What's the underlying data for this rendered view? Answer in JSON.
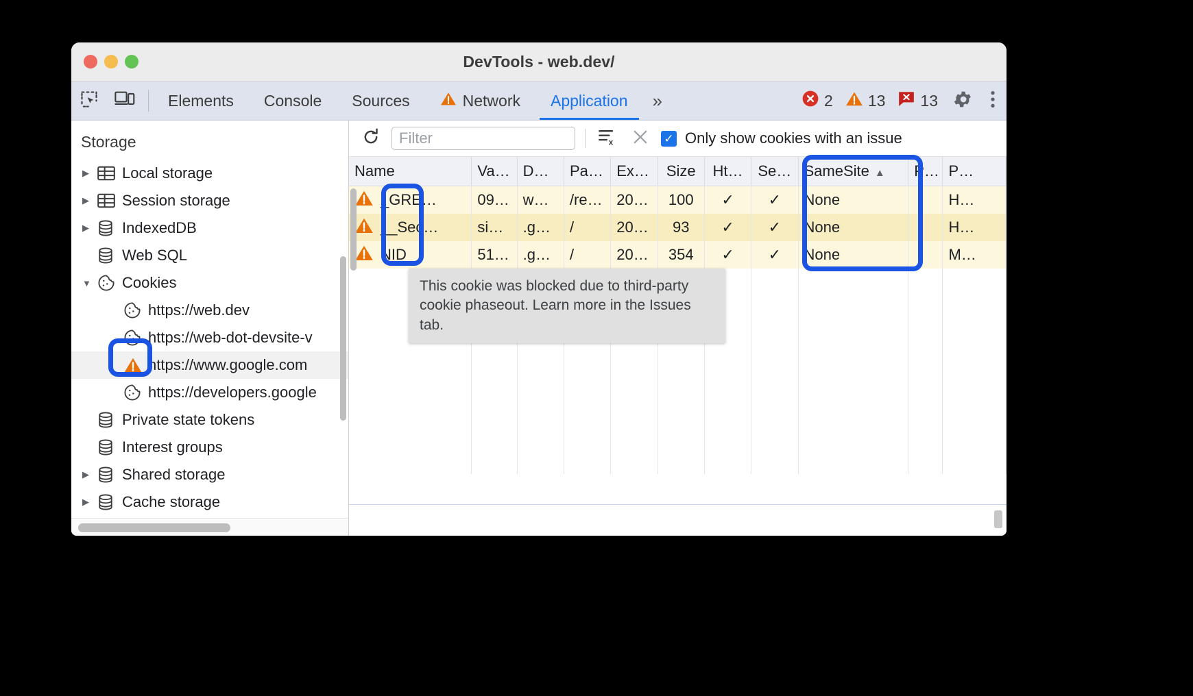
{
  "window": {
    "title": "DevTools - web.dev/"
  },
  "tabstrip": {
    "inspect_icon": "inspect-element-icon",
    "device_icon": "device-toolbar-icon",
    "tabs": [
      {
        "label": "Elements",
        "active": false,
        "warn": false
      },
      {
        "label": "Console",
        "active": false,
        "warn": false
      },
      {
        "label": "Sources",
        "active": false,
        "warn": false
      },
      {
        "label": "Network",
        "active": false,
        "warn": true
      },
      {
        "label": "Application",
        "active": true,
        "warn": false
      }
    ],
    "more_tabs": "»",
    "counters": {
      "errors": "2",
      "warnings": "13",
      "issues": "13"
    },
    "settings_icon": "gear-icon",
    "menu_icon": "kebab-menu-icon"
  },
  "sidebar": {
    "title": "Storage",
    "items": [
      {
        "label": "Local storage",
        "icon": "table-storage-icon",
        "twisty": "collapsed",
        "indent": 1,
        "selected": false
      },
      {
        "label": "Session storage",
        "icon": "table-storage-icon",
        "twisty": "collapsed",
        "indent": 1,
        "selected": false
      },
      {
        "label": "IndexedDB",
        "icon": "database-icon",
        "twisty": "collapsed",
        "indent": 1,
        "selected": false
      },
      {
        "label": "Web SQL",
        "icon": "database-icon",
        "twisty": "none",
        "indent": 1,
        "selected": false
      },
      {
        "label": "Cookies",
        "icon": "cookie-icon",
        "twisty": "expanded",
        "indent": 1,
        "selected": false
      },
      {
        "label": "https://web.dev",
        "icon": "cookie-icon",
        "twisty": "none",
        "indent": 2,
        "selected": false
      },
      {
        "label": "https://web-dot-devsite-v",
        "icon": "cookie-icon",
        "twisty": "none",
        "indent": 2,
        "selected": false
      },
      {
        "label": "https://www.google.com",
        "icon": "warning-triangle-icon",
        "twisty": "none",
        "indent": 2,
        "selected": true
      },
      {
        "label": "https://developers.google",
        "icon": "cookie-icon",
        "twisty": "none",
        "indent": 2,
        "selected": false
      },
      {
        "label": "Private state tokens",
        "icon": "database-icon",
        "twisty": "none",
        "indent": 1,
        "selected": false
      },
      {
        "label": "Interest groups",
        "icon": "database-icon",
        "twisty": "none",
        "indent": 1,
        "selected": false
      },
      {
        "label": "Shared storage",
        "icon": "database-icon",
        "twisty": "collapsed",
        "indent": 1,
        "selected": false
      },
      {
        "label": "Cache storage",
        "icon": "database-icon",
        "twisty": "collapsed",
        "indent": 1,
        "selected": false
      }
    ]
  },
  "cookies_toolbar": {
    "refresh_icon": "refresh-icon",
    "filter_placeholder": "Filter",
    "filter_value": "",
    "clear_all_icon": "clear-all-cookies-icon",
    "delete_icon": "delete-selected-cookie-icon",
    "only_issues_checked": true,
    "only_issues_label": "Only show cookies with an issue"
  },
  "cookies_table": {
    "columns": [
      {
        "key": "name",
        "label": "Name",
        "sorted": false
      },
      {
        "key": "value",
        "label": "Va…",
        "sorted": false
      },
      {
        "key": "domain",
        "label": "D…",
        "sorted": false
      },
      {
        "key": "path",
        "label": "Pa…",
        "sorted": false
      },
      {
        "key": "expires",
        "label": "Ex…",
        "sorted": false
      },
      {
        "key": "size",
        "label": "Size",
        "sorted": false
      },
      {
        "key": "httponly",
        "label": "Ht…",
        "sorted": false
      },
      {
        "key": "secure",
        "label": "Se…",
        "sorted": false
      },
      {
        "key": "samesite",
        "label": "SameSite",
        "sorted": true,
        "sort_dir": "▲"
      },
      {
        "key": "partkey",
        "label": "P…",
        "sorted": false
      },
      {
        "key": "priority",
        "label": "P…",
        "sorted": false
      }
    ],
    "rows": [
      {
        "warning": true,
        "name": "_GRE…",
        "value": "09…",
        "domain": "w…",
        "path": "/re…",
        "expires": "20…",
        "size": "100",
        "httponly": "✓",
        "secure": "✓",
        "samesite": "None",
        "partkey": "",
        "priority": "H…"
      },
      {
        "warning": true,
        "name": "__Sec…",
        "value": "si…",
        "domain": ".g…",
        "path": "/",
        "expires": "20…",
        "size": "93",
        "httponly": "✓",
        "secure": "✓",
        "samesite": "None",
        "partkey": "",
        "priority": "H…"
      },
      {
        "warning": true,
        "name": "NID",
        "value": "51…",
        "domain": ".g…",
        "path": "/",
        "expires": "20…",
        "size": "354",
        "httponly": "✓",
        "secure": "✓",
        "samesite": "None",
        "partkey": "",
        "priority": "M…"
      }
    ]
  },
  "tooltip": {
    "text": "This cookie was blocked due to third-party cookie phaseout. Learn more in the Issues tab."
  },
  "annotations": {
    "color": "#1b53e3",
    "boxes": [
      {
        "name": "sidebar-warning-highlight"
      },
      {
        "name": "name-column-warnings-highlight"
      },
      {
        "name": "samesite-column-highlight"
      }
    ]
  },
  "colors": {
    "accent": "#1a73e8",
    "warning": "#e8710a",
    "error": "#d93025",
    "issue": "#c5221f",
    "row_odd": "#fdf7dd",
    "row_even": "#f7edc0",
    "annotation": "#1b53e3"
  }
}
